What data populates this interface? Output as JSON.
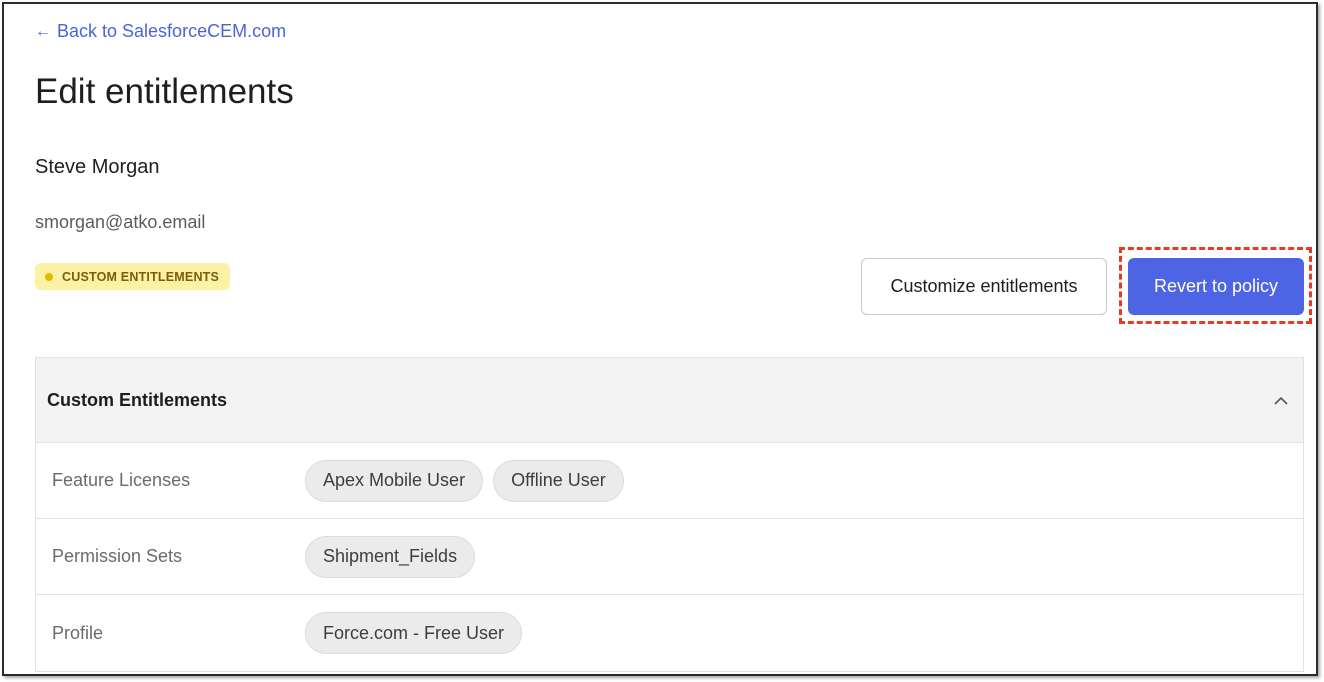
{
  "back_link": {
    "arrow": "←",
    "label": "Back to SalesforceCEM.com"
  },
  "page_title": "Edit entitlements",
  "user": {
    "name": "Steve Morgan",
    "email": "smorgan@atko.email"
  },
  "status_badge": {
    "label": "CUSTOM ENTITLEMENTS",
    "color": "#fbf2a6",
    "dot_color": "#e6b800"
  },
  "actions": {
    "customize_label": "Customize entitlements",
    "revert_label": "Revert to policy",
    "accent_color": "#4d65e5"
  },
  "panel": {
    "title": "Custom Entitlements",
    "collapse_icon": "chevron-up-icon",
    "rows": [
      {
        "label": "Feature Licenses",
        "values": [
          "Apex Mobile User",
          "Offline User"
        ]
      },
      {
        "label": "Permission Sets",
        "values": [
          "Shipment_Fields"
        ]
      },
      {
        "label": "Profile",
        "values": [
          "Force.com - Free User"
        ]
      }
    ]
  }
}
